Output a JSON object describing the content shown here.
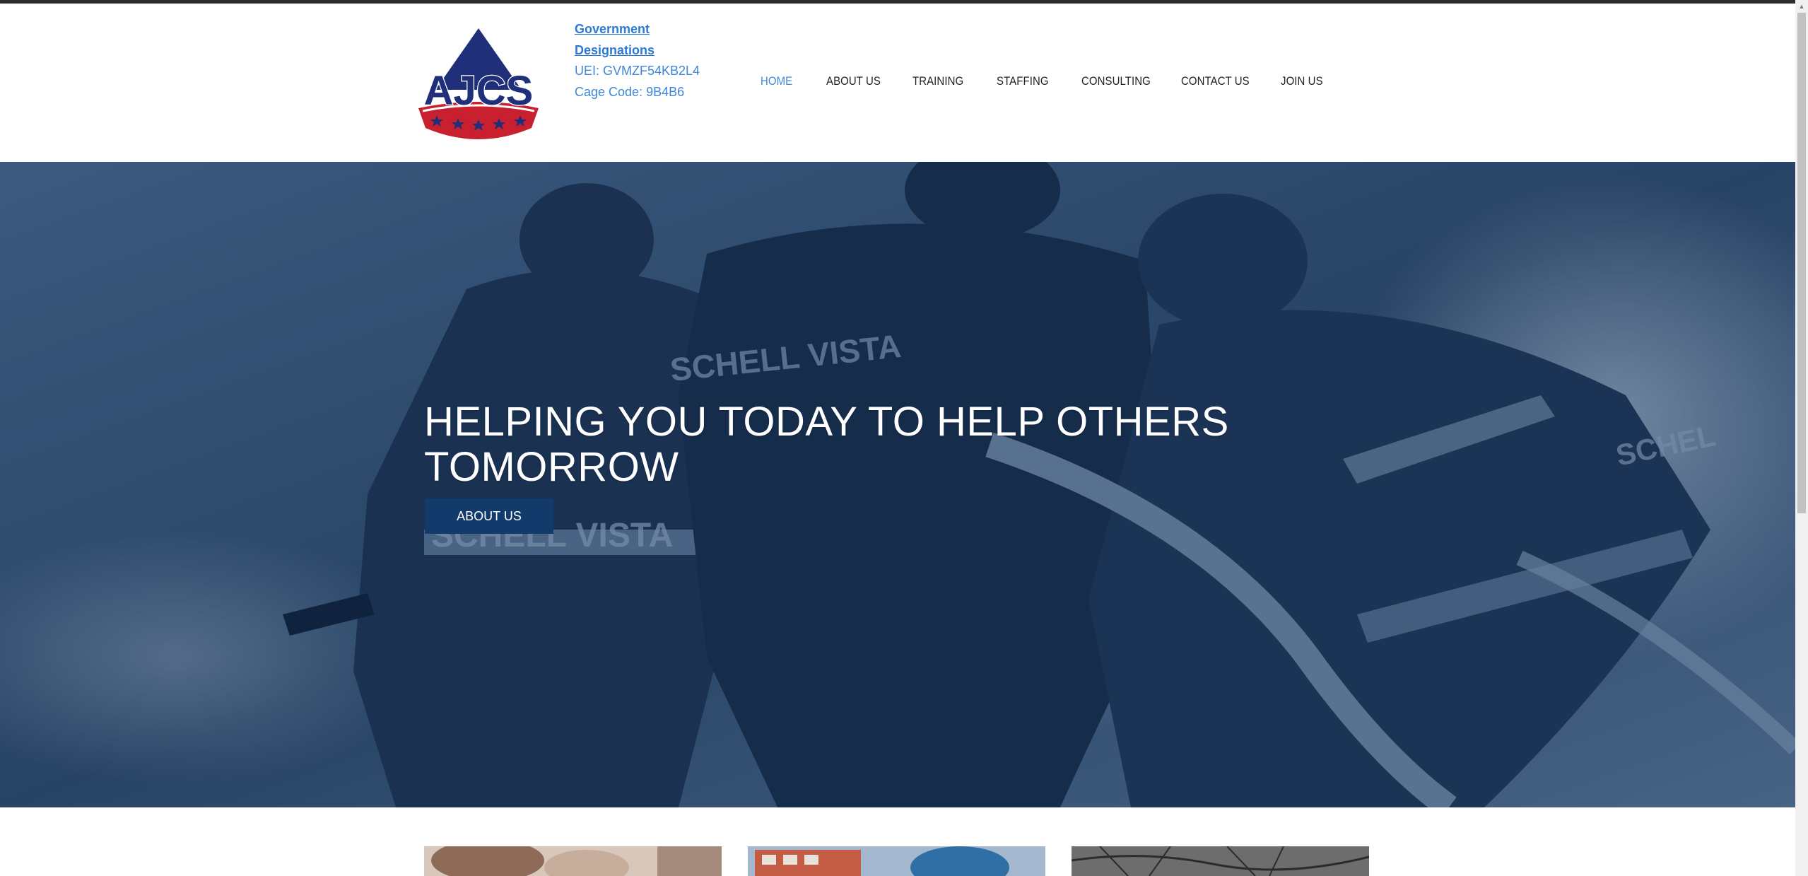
{
  "header": {
    "logo_text": "AJCS",
    "gov_link": "Government Designations",
    "uei": "UEI: GVMZF54KB2L4",
    "cage_code": "Cage Code: 9B4B6"
  },
  "nav": {
    "items": [
      {
        "label": "HOME",
        "active": true
      },
      {
        "label": "ABOUT US",
        "active": false
      },
      {
        "label": "TRAINING",
        "active": false
      },
      {
        "label": "STAFFING",
        "active": false
      },
      {
        "label": "CONSULTING",
        "active": false
      },
      {
        "label": "CONTACT US",
        "active": false
      },
      {
        "label": "JOIN US",
        "active": false
      }
    ]
  },
  "hero": {
    "title": "HELPING YOU TODAY TO HELP OTHERS TOMORROW",
    "button_label": "ABOUT US",
    "jacket_text_1": "SCHELL VISTA",
    "jacket_text_2": "SCHELL VISTA",
    "jacket_text_3": "SCHEL"
  },
  "colors": {
    "accent": "#3d86d8",
    "navy": "#123a6b",
    "logo_navy": "#1f2f7a",
    "logo_red": "#c8202f"
  }
}
